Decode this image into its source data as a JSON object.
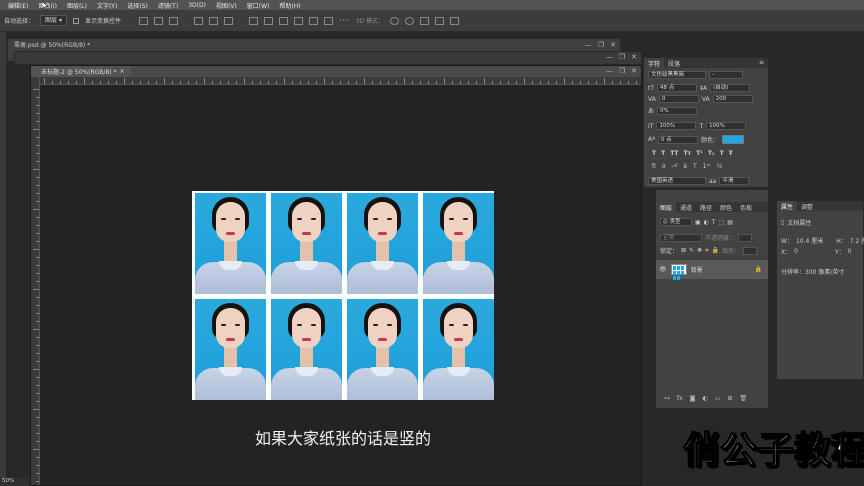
{
  "menu": [
    "编辑(E)",
    "图像(I)",
    "图层(L)",
    "文字(Y)",
    "选择(S)",
    "滤镜(T)",
    "3D(D)",
    "视图(V)",
    "窗口(W)",
    "帮助(H)"
  ],
  "options": {
    "auto_select_label": "自动选择：",
    "auto_select_value": "图层",
    "show_transform_label": "显示变换控件",
    "mode_3d_label": "3D 模式："
  },
  "docs": {
    "back_tab": "零册.psd @ 50%(RGB/8) *",
    "front_tab": "未标题-2 @ 50%(RGB/8) *"
  },
  "character": {
    "tabs": [
      "字符",
      "段落"
    ],
    "font_family": "文仿幼黑黑简",
    "font_style": "-",
    "font_size": "48 点",
    "leading": "(自动)",
    "kerning": "0",
    "tracking": "200",
    "scale_label": "0%",
    "vertical_scale": "100%",
    "horizontal_scale": "100%",
    "baseline": "0 点",
    "color_label": "颜色：",
    "language": "美国英语",
    "antialias": "平滑",
    "color": "#1ea8e6"
  },
  "layers": {
    "tabs": [
      "图层",
      "通道",
      "路径",
      "颜色",
      "色板"
    ],
    "filter_label": "类型",
    "blend_mode": "正常",
    "opacity_label": "不透明度：",
    "lock_label": "锁定：",
    "fill_label": "填充：",
    "layer_name": "背景"
  },
  "properties": {
    "tabs": [
      "属性",
      "调整"
    ],
    "title": "文档属性",
    "width_label": "W：",
    "width_value": "10.4 厘米",
    "height_label": "H：",
    "height_value": "7.2 厘",
    "x_label": "X：",
    "x_value": "0",
    "y_label": "Y：",
    "y_value": "0",
    "resolution": "分辨率：300 像素/英寸"
  },
  "subtitle": "如果大家纸张的话是竖的",
  "watermark": "俏公子教程",
  "status_zoom": "50%"
}
